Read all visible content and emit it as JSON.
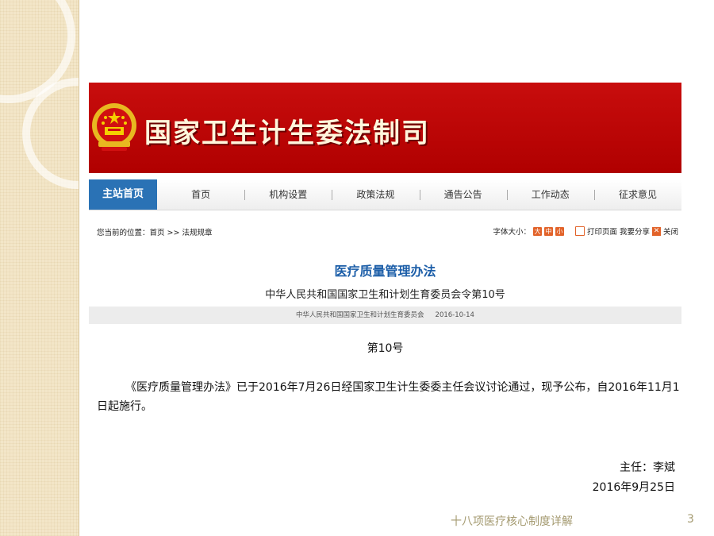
{
  "banner": {
    "title": "国家卫生计生委法制司"
  },
  "nav": {
    "home_label": "主站首页",
    "items": [
      {
        "label": "首页"
      },
      {
        "label": "机构设置"
      },
      {
        "label": "政策法规"
      },
      {
        "label": "通告公告"
      },
      {
        "label": "工作动态"
      },
      {
        "label": "征求意见"
      }
    ]
  },
  "breadcrumb": {
    "text": "您当前的位置：首页 >> 法规规章"
  },
  "tools": {
    "font_size_label": "字体大小：",
    "size_large": "大",
    "size_medium": "中",
    "size_small": "小",
    "print_label": "打印页面",
    "share_label": "我要分享",
    "close_label": "关闭"
  },
  "article": {
    "title": "医疗质量管理办法",
    "subtitle": "中华人民共和国国家卫生和计划生育委员会令第10号",
    "source": "中华人民共和国国家卫生和计划生育委员会",
    "date": "2016-10-14",
    "doc_number": "第10号",
    "body": "《医疗质量管理办法》已于2016年7月26日经国家卫生计生委委主任会议讨论通过，现予公布，自2016年11月1日起施行。",
    "signer": "主任：李斌",
    "sign_date": "2016年9月25日"
  },
  "slide": {
    "footer": "十八项医疗核心制度详解",
    "page_number": "3"
  },
  "colors": {
    "banner_red": "#c00000",
    "nav_home_blue": "#2a72b5",
    "title_blue": "#1c5ea8",
    "tool_orange": "#e2632a",
    "footer_text": "#a49a70"
  }
}
